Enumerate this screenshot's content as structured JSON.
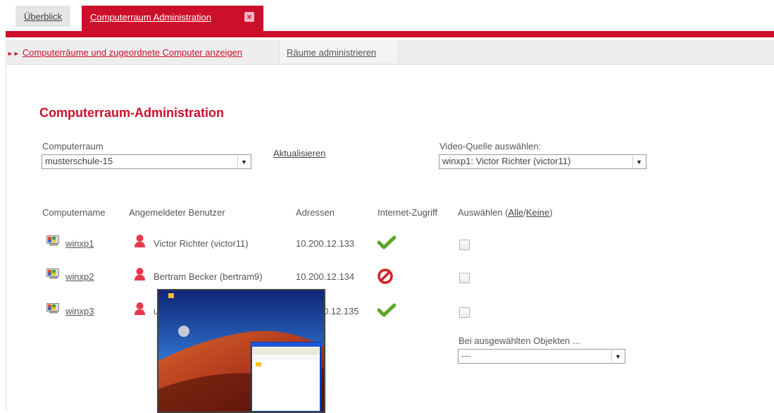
{
  "tabs": {
    "overview": "Überblick",
    "active": "Computerraum Administration"
  },
  "subnav": {
    "item1": "Computerräume und zugeordnete Computer anzeigen",
    "item2": "Räume administrieren"
  },
  "page_title": "Computerraum-Administration",
  "room": {
    "label": "Computerraum",
    "value": "musterschule-15",
    "refresh": "Aktualisieren"
  },
  "video": {
    "label": "Video-Quelle auswählen:",
    "value": "winxp1: Victor Richter (victor11)"
  },
  "table": {
    "headers": {
      "name": "Computername",
      "user": "Angemeldeter Benutzer",
      "address": "Adressen",
      "internet": "Internet-Zugriff",
      "select_prefix": "Auswählen (",
      "select_all": "Alle",
      "select_sep": "/",
      "select_none": "Keine",
      "select_suffix": ")"
    },
    "rows": [
      {
        "name": "winxp1",
        "user": "Victor Richter (victor11)",
        "address": "10.200.12.133",
        "internet": "allowed"
      },
      {
        "name": "winxp2",
        "user": "Bertram Becker (bertram9)",
        "address": "10.200.12.134",
        "internet": "blocked"
      },
      {
        "name": "winxp3",
        "user": "u",
        "address": "0.12.135",
        "internet": "allowed"
      }
    ]
  },
  "bulk": {
    "label": "Bei ausgewählten Objekten ...",
    "value": "---"
  },
  "colors": {
    "accent": "#cc0f2b",
    "ok": "#5aa626",
    "deny": "#d42020"
  }
}
